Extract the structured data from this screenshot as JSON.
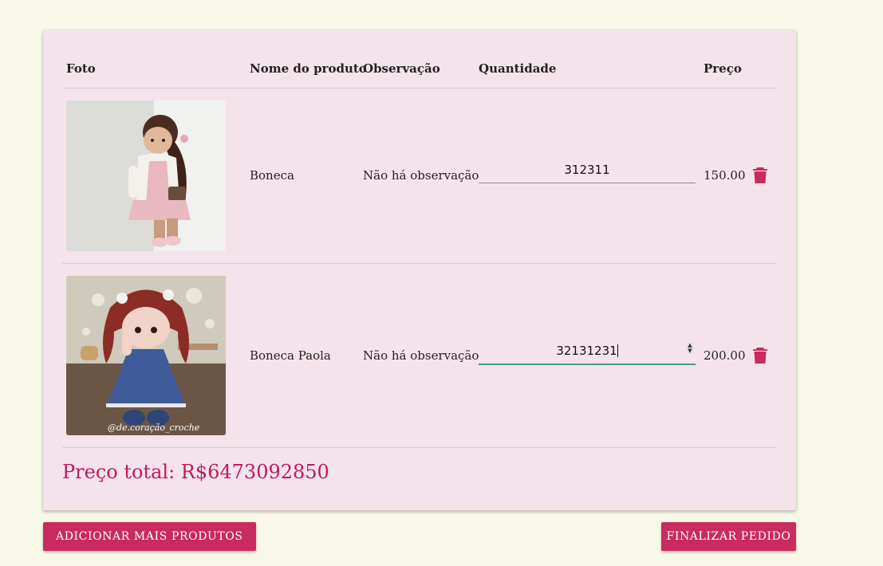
{
  "table": {
    "headers": {
      "photo": "Foto",
      "name": "Nome do produto",
      "note": "Observação",
      "quantity": "Quantidade",
      "price": "Preço"
    },
    "rows": [
      {
        "name": "Boneca",
        "note": "Não há observação",
        "quantity": "312311",
        "price": "150.00",
        "photo_icon": "doll-photo"
      },
      {
        "name": "Boneca Paola",
        "note": "Não há observação",
        "quantity": "32131231",
        "price": "200.00",
        "photo_icon": "doll-photo",
        "photo_watermark": "@de.coração_croche"
      }
    ]
  },
  "total": "Preço total: R$6473092850",
  "buttons": {
    "add_more": "ADICIONAR MAIS PRODUTOS",
    "finish": "FINALIZAR PEDIDO"
  },
  "colors": {
    "accent": "#c92a5f",
    "card_bg": "#f5e3ec",
    "page_bg": "#f8f8e8",
    "focus": "#4a9a8a"
  }
}
